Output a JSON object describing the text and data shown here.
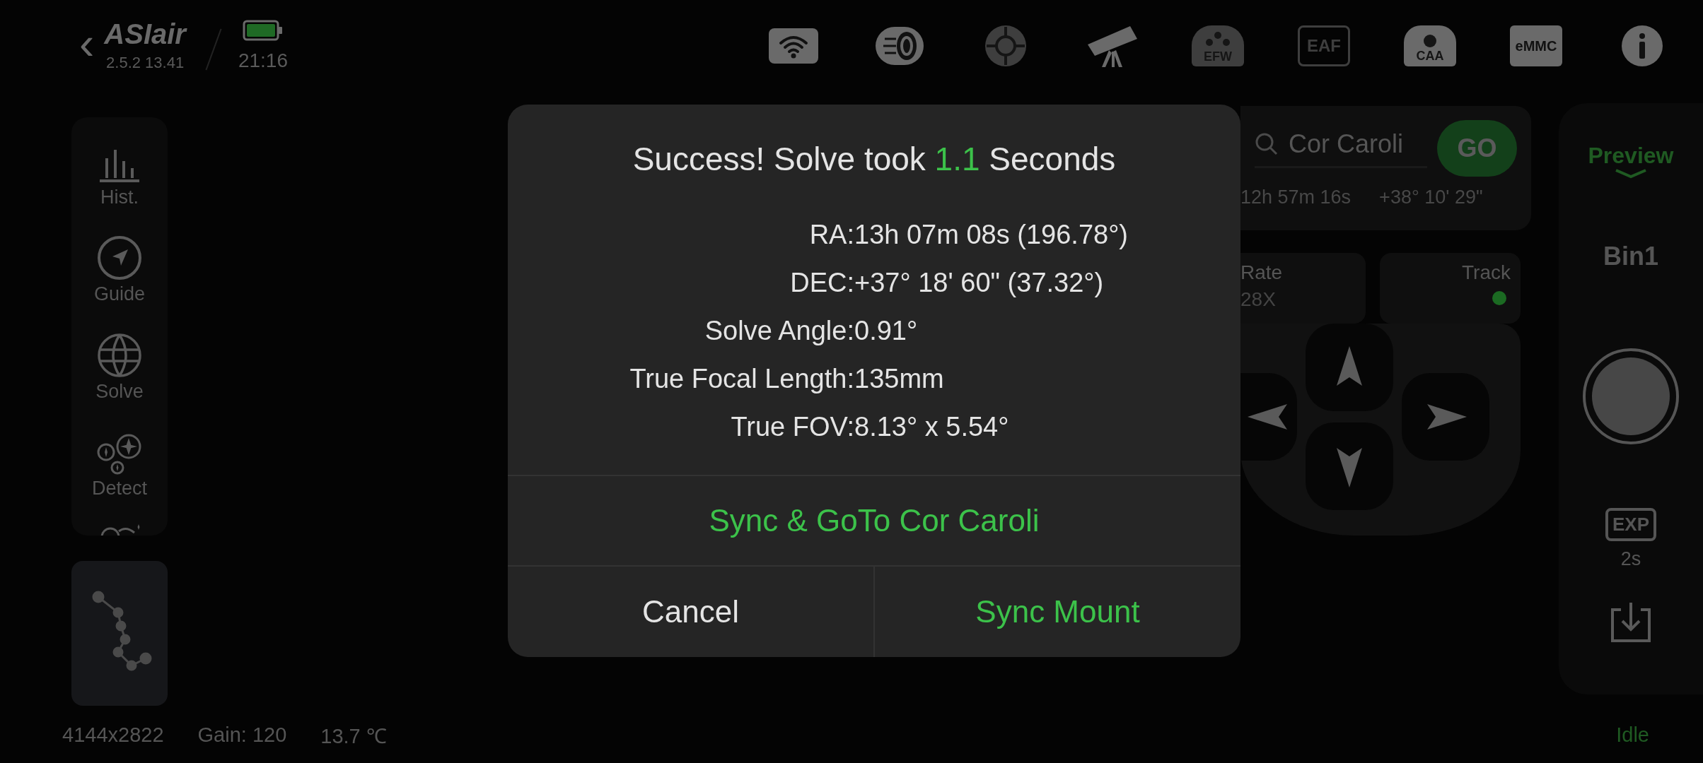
{
  "top_bar": {
    "back": "‹",
    "logo": "ASIair",
    "version": "2.5.2 13.41",
    "time": "21:16",
    "devices": [
      {
        "kind": "wifi"
      },
      {
        "kind": "camera"
      },
      {
        "kind": "guide"
      },
      {
        "kind": "telescope"
      },
      {
        "kind": "efw",
        "label": "EFW"
      },
      {
        "kind": "eaf",
        "label": "EAF"
      },
      {
        "kind": "caa",
        "label": "CAA"
      },
      {
        "kind": "emmc",
        "label": "eMMC"
      },
      {
        "kind": "info"
      }
    ]
  },
  "sidebar": {
    "items": [
      {
        "kind": "histogram",
        "label": "Hist."
      },
      {
        "kind": "guide",
        "label": "Guide"
      },
      {
        "kind": "solve",
        "label": "Solve"
      },
      {
        "kind": "detect",
        "label": "Detect"
      }
    ]
  },
  "mount": {
    "target": "Cor Caroli",
    "go": "GO",
    "ra": "12h 57m 16s",
    "dec": "+38° 10' 29\"",
    "rate": {
      "label": "Rate",
      "value": "28X"
    },
    "track": {
      "label": "Track",
      "on": true
    }
  },
  "capture": {
    "mode": "Preview",
    "bin": "Bin1",
    "exp_label": "EXP",
    "exposure": "2s"
  },
  "status_bar": {
    "resolution": "4144x2822",
    "gain": "Gain: 120",
    "temperature": "13.7 ℃",
    "state": "Idle"
  },
  "dialog": {
    "title": {
      "prefix": "Success! Solve took",
      "value": "1.1",
      "suffix": "Seconds"
    },
    "details": [
      {
        "label": "RA:",
        "value": "13h 07m 08s (196.78°)"
      },
      {
        "label": "DEC:",
        "value": "+37° 18' 60\" (37.32°)"
      },
      {
        "label": "Solve Angle:",
        "value": "0.91°"
      },
      {
        "label": "True Focal Length:",
        "value": "135mm"
      },
      {
        "label": "True FOV:",
        "value": "8.13° x 5.54°"
      }
    ],
    "actions": [
      {
        "label": "Sync & GoTo Cor Caroli",
        "kind": "accent"
      }
    ],
    "buttons": [
      {
        "label": "Cancel",
        "kind": "plain"
      },
      {
        "label": "Sync Mount",
        "kind": "accent"
      }
    ]
  }
}
